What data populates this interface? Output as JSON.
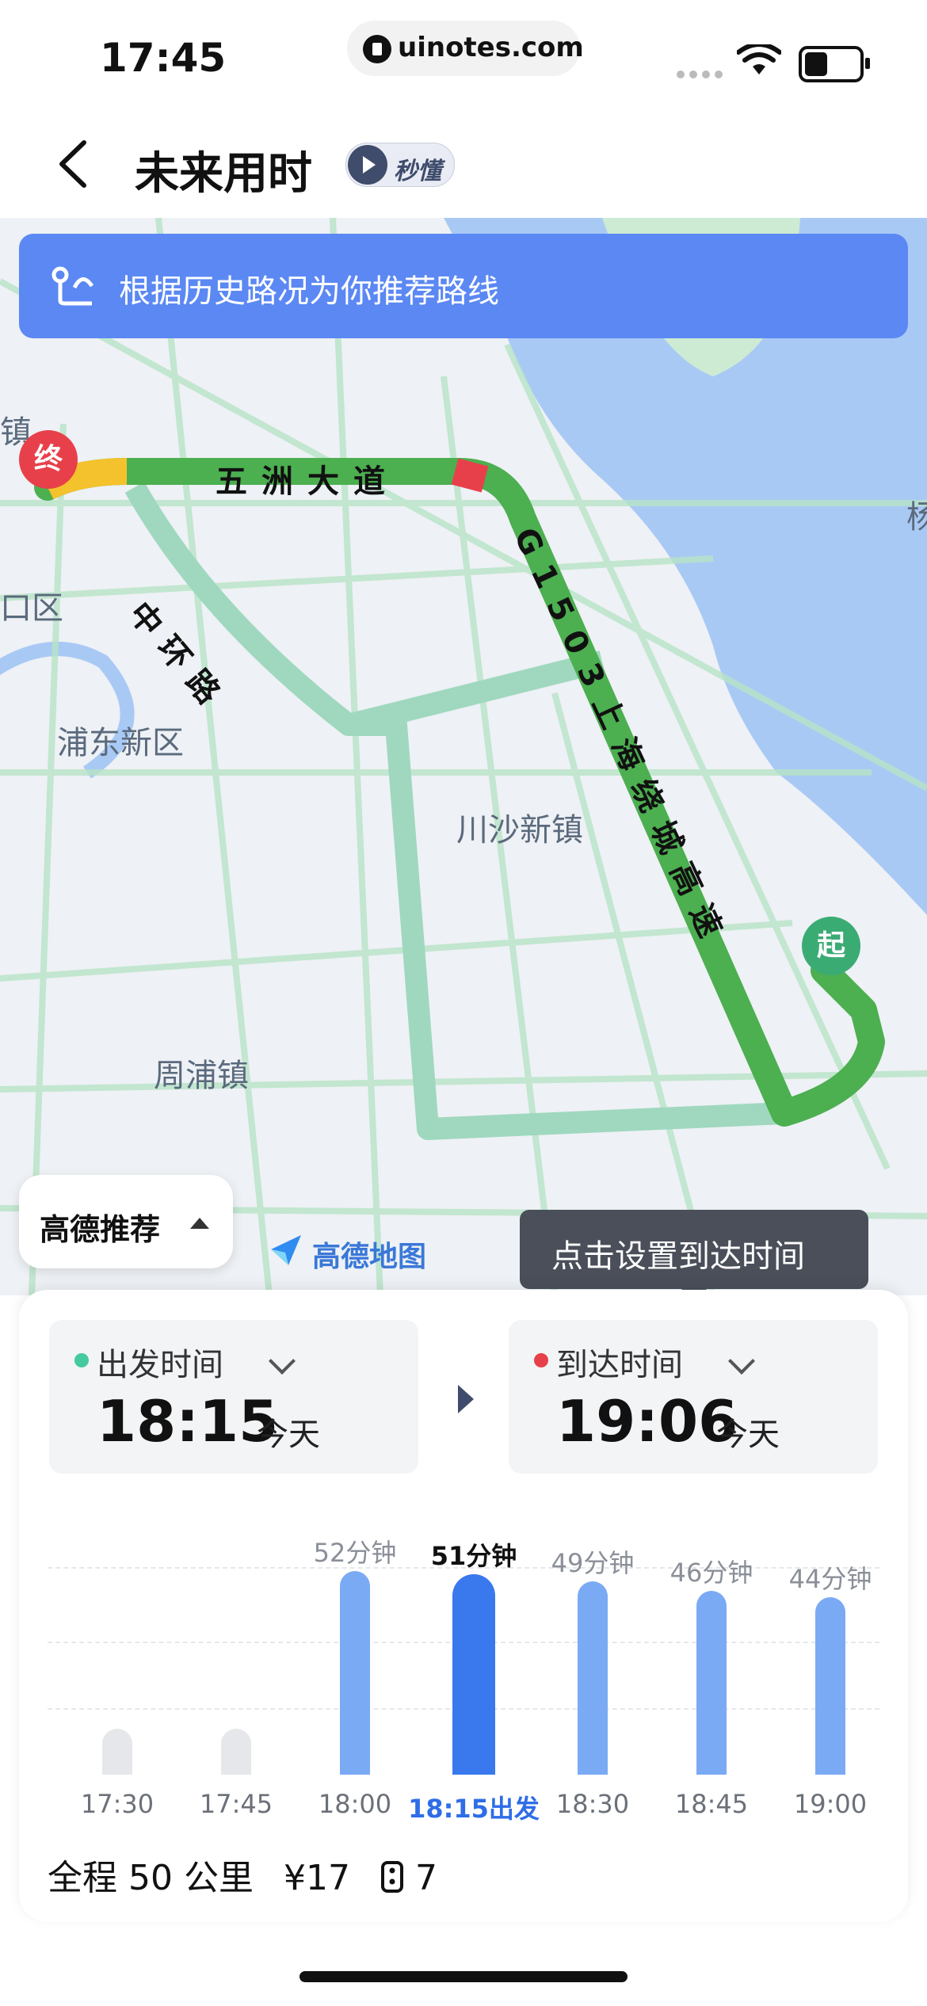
{
  "status_bar": {
    "time": "17:45",
    "url": "uinotes.com"
  },
  "header": {
    "title": "未来用时",
    "badge_label": "秒懂"
  },
  "map": {
    "banner_text": "根据历史路况为你推荐路线",
    "labels": {
      "wuzhou_road": "五洲大道",
      "middle_ring": "中环路",
      "expressway": "G1503上海绕城高速",
      "pudong": "浦东新区",
      "chuansha": "川沙新镇",
      "zhoupu": "周浦镇",
      "kou_district": "口区",
      "zhen_edge": "镇",
      "yang_edge": "杨"
    },
    "pins": {
      "end": "终",
      "start": "起"
    },
    "recommend_button": "高德推荐",
    "logo_text": "高德地图",
    "tooltip": "点击设置到达时间",
    "colors": {
      "water": "#a9c9f5",
      "green_land": "#cdebd3",
      "route_main": "#4caf50",
      "route_alt": "#9fd8bf",
      "road": "#b6e3c5"
    }
  },
  "panel": {
    "departure": {
      "label": "出发时间",
      "time": "18:15",
      "day": "今天"
    },
    "arrival": {
      "label": "到达时间",
      "time": "19:06",
      "day": "今天"
    },
    "summary": {
      "distance": "全程 50 公里",
      "toll": "¥17",
      "lights": "7"
    }
  },
  "chart_data": {
    "type": "bar",
    "categories": [
      "17:30",
      "17:45",
      "18:00",
      "18:15出发",
      "18:30",
      "18:45",
      "19:00"
    ],
    "values": [
      null,
      null,
      52,
      51,
      49,
      46,
      44
    ],
    "value_labels": [
      "",
      "",
      "52分钟",
      "51分钟",
      "49分钟",
      "46分钟",
      "44分钟"
    ],
    "selected_index": 3,
    "ylim": [
      0,
      60
    ],
    "grid": true,
    "colors": {
      "bar": "#7baaf5",
      "selected": "#3a78ee",
      "empty": "#e6e7ea"
    }
  }
}
